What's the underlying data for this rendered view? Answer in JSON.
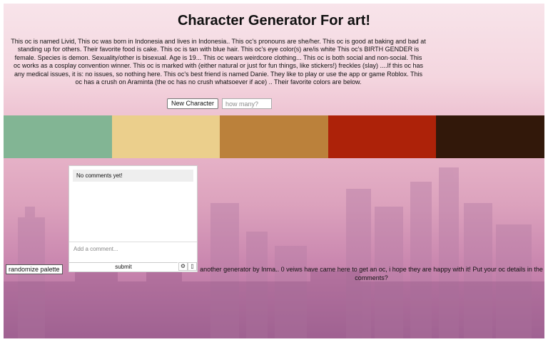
{
  "header": {
    "title": "Character Generator For art!"
  },
  "description": "This oc is named Livid, This oc was born in Indonesia and lives in Indonesia.. This oc's pronouns are she/her. This oc is good at baking and bad at standing up for others. Their favorite food is cake. This oc is tan with blue hair. This oc's eye color(s) are/is white This oc's BIRTH GENDER is female. Species is demon. Sexuality/other is bisexual. Age is 19... This oc wears weirdcore clothing... This oc is both social and non-social. This oc works as a cosplay convention winner. This oc is marked with (either natural or just for fun things, like stickers!) freckles (slay) ....If this oc has any medical issues, it is: no issues, so nothing here. This oc's best friend is named Danie. They like to play or use the app or game Roblox. This oc has a crush on Araminta (the oc has no crush whatsoever if ace) .. Their favorite colors are below.",
  "controls": {
    "new_character_label": "New Character",
    "how_many_placeholder": "how many?"
  },
  "palette": {
    "colors": [
      "#82b594",
      "#ebcf8c",
      "#bb813b",
      "#ad2209",
      "#32180a"
    ]
  },
  "comments": {
    "empty_text": "No comments yet!",
    "input_placeholder": "Add a comment...",
    "submit_label": "submit",
    "settings_icon": "⚙",
    "options_icon": "▯"
  },
  "randomize_label": "randomize palette",
  "footer_text": "another generator by Inma.. 0 veiws have came here to get an oc, i hope they are happy with it! Put your oc details in the comments?"
}
